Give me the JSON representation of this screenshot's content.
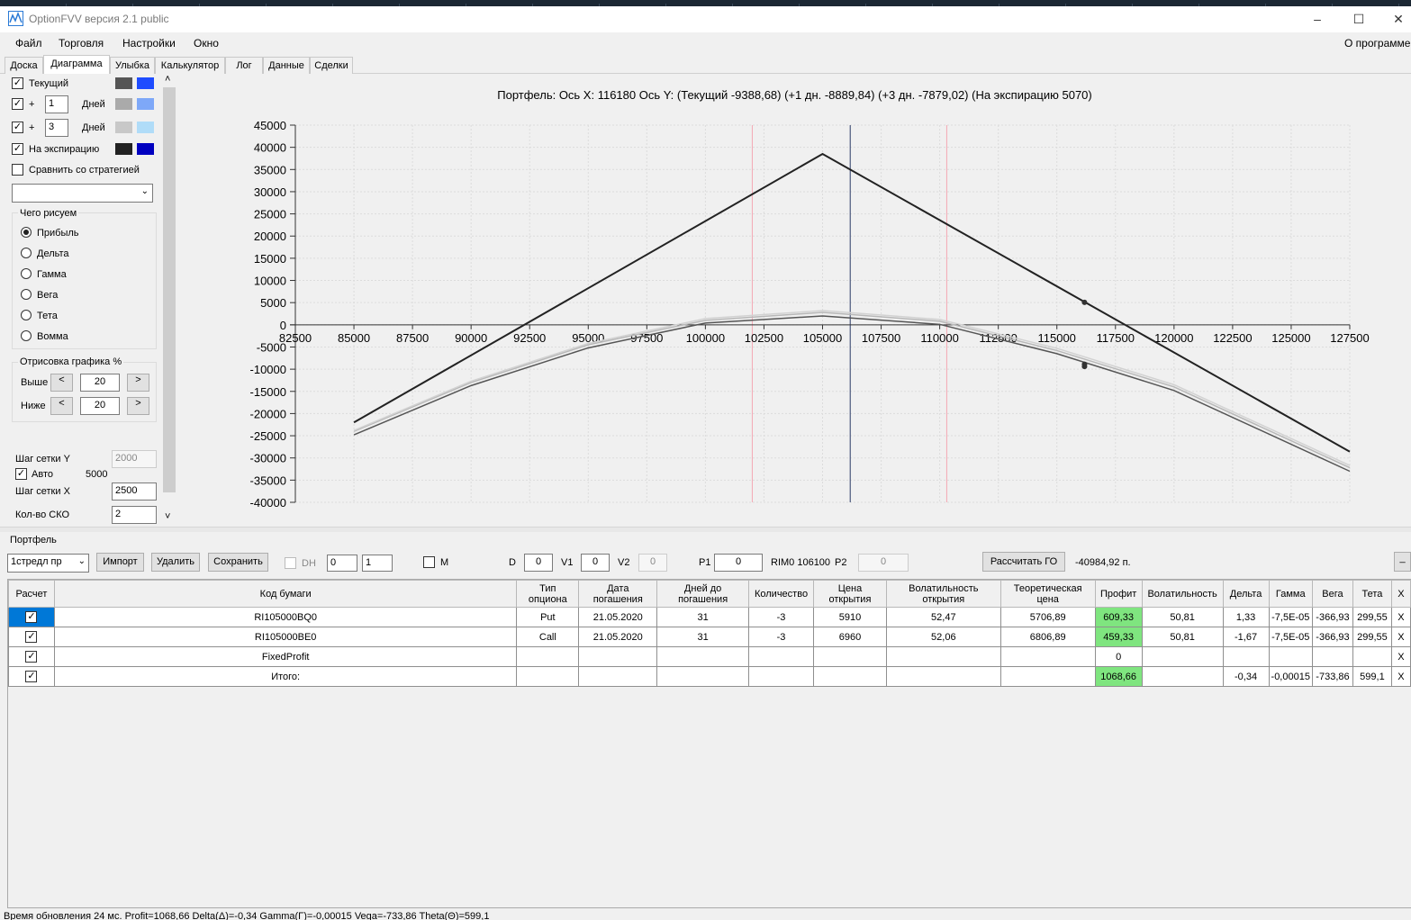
{
  "window": {
    "title": "OptionFVV версия 2.1 public"
  },
  "menu": {
    "items": [
      "Файл",
      "Торговля",
      "Настройки",
      "Окно"
    ],
    "about": "О программе"
  },
  "tabs": [
    "Доска",
    "Диаграмма",
    "Улыбка",
    "Калькулятор",
    "Лог",
    "Данные",
    "Сделки"
  ],
  "controls": {
    "current_label": "Текущий",
    "plus": "+",
    "days_label": "Дней",
    "days1": "1",
    "days2": "3",
    "expiry_label": "На экспирацию",
    "compare_label": "Сравнить со стратегией",
    "draw_group": "Чего рисуем",
    "draw_options": [
      "Прибыль",
      "Дельта",
      "Гамма",
      "Вега",
      "Тета",
      "Вомма"
    ],
    "render_group": "Отрисовка графика %",
    "above_label": "Выше",
    "below_label": "Ниже",
    "above_value": "20",
    "below_value": "20",
    "lt": "<",
    "gt": ">",
    "grid_y_label": "Шаг сетки Y",
    "grid_y_value": "2000",
    "auto_label": "Авто",
    "auto_value": "5000",
    "grid_x_label": "Шаг сетки X",
    "grid_x_value": "2500",
    "sko_label": "Кол-во СКО",
    "sko_value": "2",
    "scroll_up": "˄",
    "scroll_down": "˅",
    "colors": {
      "current": [
        "#555555",
        "#1e4cff"
      ],
      "day1": [
        "#aaaaaa",
        "#7ea8f8"
      ],
      "day3": [
        "#c8c8c8",
        "#b0dcf8"
      ],
      "expiry": [
        "#222222",
        "#0000c0"
      ]
    }
  },
  "chart_title": "Портфель: Ось X: 116180 Ось Y:  (Текущий -9388,68)  (+1 дн. -8889,84)  (+3 дн. -7879,02)  (На экспирацию 5070)",
  "chart_data": {
    "type": "line",
    "xlim": [
      82500,
      127500
    ],
    "ylim": [
      -40000,
      45000
    ],
    "x_ticks": [
      82500,
      85000,
      87500,
      90000,
      92500,
      95000,
      97500,
      100000,
      102500,
      105000,
      107500,
      110000,
      112500,
      115000,
      117500,
      120000,
      122500,
      125000,
      127500
    ],
    "y_ticks": [
      45000,
      40000,
      35000,
      30000,
      25000,
      20000,
      15000,
      10000,
      5000,
      0,
      -5000,
      -10000,
      -15000,
      -20000,
      -25000,
      -30000,
      -35000,
      -40000
    ],
    "grid": true,
    "vertical_markers": [
      {
        "x": 102000,
        "color": "#f4a8b4"
      },
      {
        "x": 106180,
        "color": "#2b3a66"
      },
      {
        "x": 110300,
        "color": "#f4a8b4"
      }
    ],
    "series": [
      {
        "color": "#222222",
        "x": [
          85000,
          105000,
          127500
        ],
        "y": [
          -22000,
          38500,
          -28600
        ]
      },
      {
        "color": "#b8b8b8",
        "x": [
          85000,
          90000,
          95000,
          100000,
          105000,
          110000,
          115000,
          120000,
          127500
        ],
        "y": [
          -24000,
          -13000,
          -4500,
          1000,
          2800,
          800,
          -5800,
          -14000,
          -32200
        ]
      },
      {
        "color": "#d2d2d2",
        "x": [
          85000,
          90000,
          95000,
          100000,
          105000,
          110000,
          115000,
          120000,
          127500
        ],
        "y": [
          -23800,
          -12700,
          -4200,
          1400,
          3200,
          1200,
          -5300,
          -13500,
          -31700
        ]
      },
      {
        "color": "#555555",
        "x": [
          85000,
          90000,
          95000,
          100000,
          105000,
          110000,
          115000,
          120000,
          127500
        ],
        "y": [
          -24800,
          -13700,
          -5200,
          400,
          2000,
          100,
          -6500,
          -14800,
          -33000
        ]
      }
    ],
    "points": [
      {
        "x": 116180,
        "y": 5070
      },
      {
        "x": 116180,
        "y": -9388.68
      },
      {
        "x": 116180,
        "y": -8889.84
      }
    ]
  },
  "portfolio": {
    "label": "Портфель",
    "strategy": "1стредл пр",
    "import": "Импорт",
    "delete": "Удалить",
    "save": "Сохранить",
    "dh": "DH",
    "spin1": "0",
    "spin2": "1",
    "m": "M",
    "d": "D",
    "d_value": "0",
    "v1": "V1",
    "v1_value": "0",
    "v2": "V2",
    "v2_value": "0",
    "p1": "P1",
    "p1_value": "0",
    "rim": "RIM0 106100",
    "p2": "P2",
    "p2_value": "0",
    "calc_go": "Рассчитать ГО",
    "go_value": "-40984,92 п.",
    "extra": "_"
  },
  "table": {
    "headers": [
      "Расчет",
      "Код бумаги",
      "Тип опциона",
      "Дата погашения",
      "Дней до погашения",
      "Количество",
      "Цена открытия",
      "Волатильность открытия",
      "Теоретическая цена",
      "Профит",
      "Волатильность",
      "Дельта",
      "Гамма",
      "Вега",
      "Тета",
      "X"
    ],
    "rows": [
      [
        "✓",
        "RI105000BQ0",
        "Put",
        "21.05.2020",
        "31",
        "-3",
        "5910",
        "52,47",
        "5706,89",
        "609,33",
        "50,81",
        "1,33",
        "-7,5E-05",
        "-366,93",
        "299,55",
        "X"
      ],
      [
        "✓",
        "RI105000BE0",
        "Call",
        "21.05.2020",
        "31",
        "-3",
        "6960",
        "52,06",
        "6806,89",
        "459,33",
        "50,81",
        "-1,67",
        "-7,5E-05",
        "-366,93",
        "299,55",
        "X"
      ],
      [
        "✓",
        "FixedProfit",
        "",
        "",
        "",
        "",
        "",
        "",
        "",
        "0",
        "",
        "",
        "",
        "",
        "",
        "X"
      ],
      [
        "✓",
        "Итого:",
        "",
        "",
        "",
        "",
        "",
        "",
        "",
        "1068,66",
        "",
        "-0,34",
        "-0,00015",
        "-733,86",
        "599,1",
        "X"
      ]
    ]
  },
  "status": "Время обновления 24 мс. Profit=1068,66 Delta(Δ)=-0,34 Gamma(Γ)=-0,00015 Vega=-733,86 Theta(Θ)=599,1"
}
